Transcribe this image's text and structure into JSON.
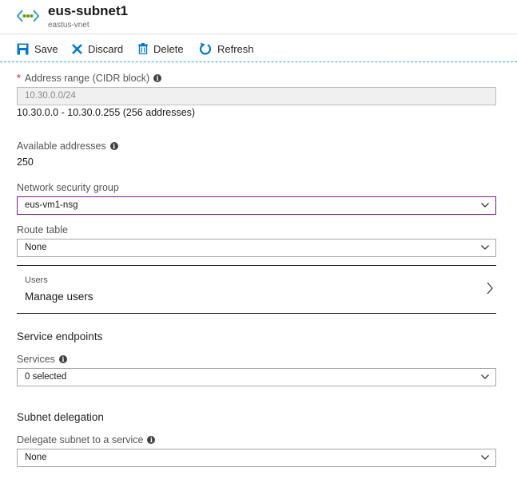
{
  "header": {
    "icon": "subnet-icon",
    "title": "eus-subnet1",
    "subtitle": "eastus-vnet"
  },
  "toolbar": {
    "save_label": "Save",
    "discard_label": "Discard",
    "delete_label": "Delete",
    "refresh_label": "Refresh"
  },
  "form": {
    "address_range": {
      "required_mark": "*",
      "label": "Address range (CIDR block)",
      "value": "10.30.0.0/24",
      "range_text": "10.30.0.0 - 10.30.0.255 (256 addresses)"
    },
    "available_addresses": {
      "label": "Available addresses",
      "value": "250"
    },
    "nsg": {
      "label": "Network security group",
      "selected": "eus-vm1-nsg"
    },
    "route_table": {
      "label": "Route table",
      "selected": "None"
    },
    "users": {
      "caption": "Users",
      "link_text": "Manage users"
    },
    "service_endpoints": {
      "section_title": "Service endpoints",
      "label": "Services",
      "selected": "0 selected"
    },
    "subnet_delegation": {
      "section_title": "Subnet delegation",
      "label": "Delegate subnet to a service",
      "selected": "None"
    }
  },
  "colors": {
    "accent_blue": "#0078d4",
    "focus_purple": "#7b1c8d",
    "required_red": "#e00b1c",
    "icon_green": "#57a300"
  },
  "info_glyph": "i"
}
